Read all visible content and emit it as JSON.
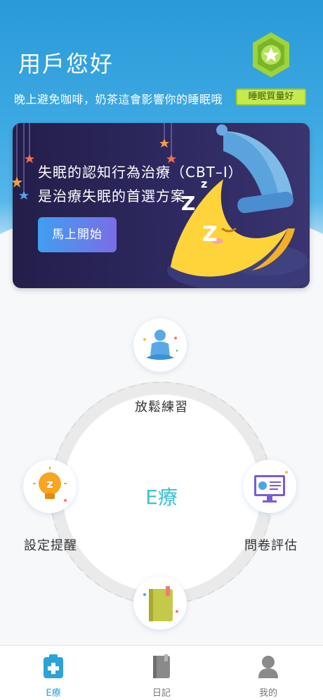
{
  "header": {
    "greeting": "用戶您好",
    "subtitle": "晚上避免咖啡，奶茶這會影響你的睡眠哦",
    "sleep_badge": {
      "label": "睡眠質量好",
      "icon": "star-hexagon-badge-icon",
      "color": "#c6ea4e"
    }
  },
  "banner": {
    "line1": "失眠的認知行為治療（CBT–I）",
    "line2": "是治療失眠的首選方案",
    "cta_label": "馬上開始",
    "illustration": "sleeping-moon-icon",
    "zzz": [
      "z",
      "Z",
      "Z"
    ]
  },
  "hub": {
    "center_label": "E療",
    "items": [
      {
        "label": "放鬆練習",
        "icon": "meditation-person-icon"
      },
      {
        "label": "設定提醒",
        "icon": "lightbulb-reminder-icon"
      },
      {
        "label": "問卷評估",
        "icon": "monitor-questionnaire-icon"
      },
      {
        "label": "",
        "icon": "diary-book-icon"
      }
    ]
  },
  "tabbar": {
    "tabs": [
      {
        "label": "E療",
        "icon": "medical-kit-icon",
        "active": true
      },
      {
        "label": "日記",
        "icon": "diary-icon",
        "active": false
      },
      {
        "label": "我的",
        "icon": "user-profile-icon",
        "active": false
      }
    ]
  },
  "colors": {
    "header_blue": "#2a9ad8",
    "accent_cyan": "#3cc0d6",
    "badge_green": "#c6ea4e",
    "banner_navy": "#2e2960"
  }
}
